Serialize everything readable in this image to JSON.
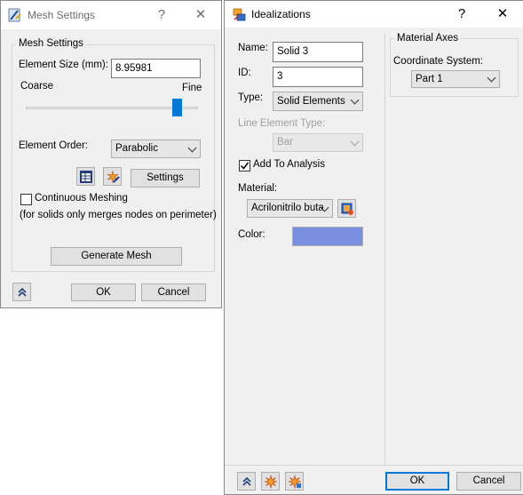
{
  "mesh_dialog": {
    "title": "Mesh Settings",
    "help": "?",
    "close": "✕",
    "group_title": "Mesh Settings",
    "element_size_label": "Element Size (mm):",
    "element_size_value": "8.95981",
    "coarse_label": "Coarse",
    "fine_label": "Fine",
    "slider_level": 0.9,
    "element_order_label": "Element Order:",
    "element_order_value": "Parabolic",
    "settings_button": "Settings",
    "continuous_meshing_label": "Continuous Meshing",
    "continuous_meshing_checked": false,
    "note": "(for solids only merges nodes on perimeter)",
    "generate_button": "Generate Mesh",
    "ok_button": "OK",
    "cancel_button": "Cancel"
  },
  "idealizations_dialog": {
    "title": "Idealizations",
    "help": "?",
    "close": "✕",
    "name_label": "Name:",
    "name_value": "Solid 3",
    "id_label": "ID:",
    "id_value": "3",
    "type_label": "Type:",
    "type_value": "Solid Elements",
    "line_element_type_label": "Line Element Type:",
    "line_element_type_value": "Bar",
    "add_to_analysis_label": "Add To Analysis",
    "add_to_analysis_checked": true,
    "material_label": "Material:",
    "material_value": "Acrilonitrilo buta",
    "color_label": "Color:",
    "color_value": "#7b8fe0",
    "material_axes_title": "Material Axes",
    "coordinate_system_label": "Coordinate System:",
    "coordinate_system_value": "Part 1",
    "ok_button": "OK",
    "cancel_button": "Cancel"
  }
}
